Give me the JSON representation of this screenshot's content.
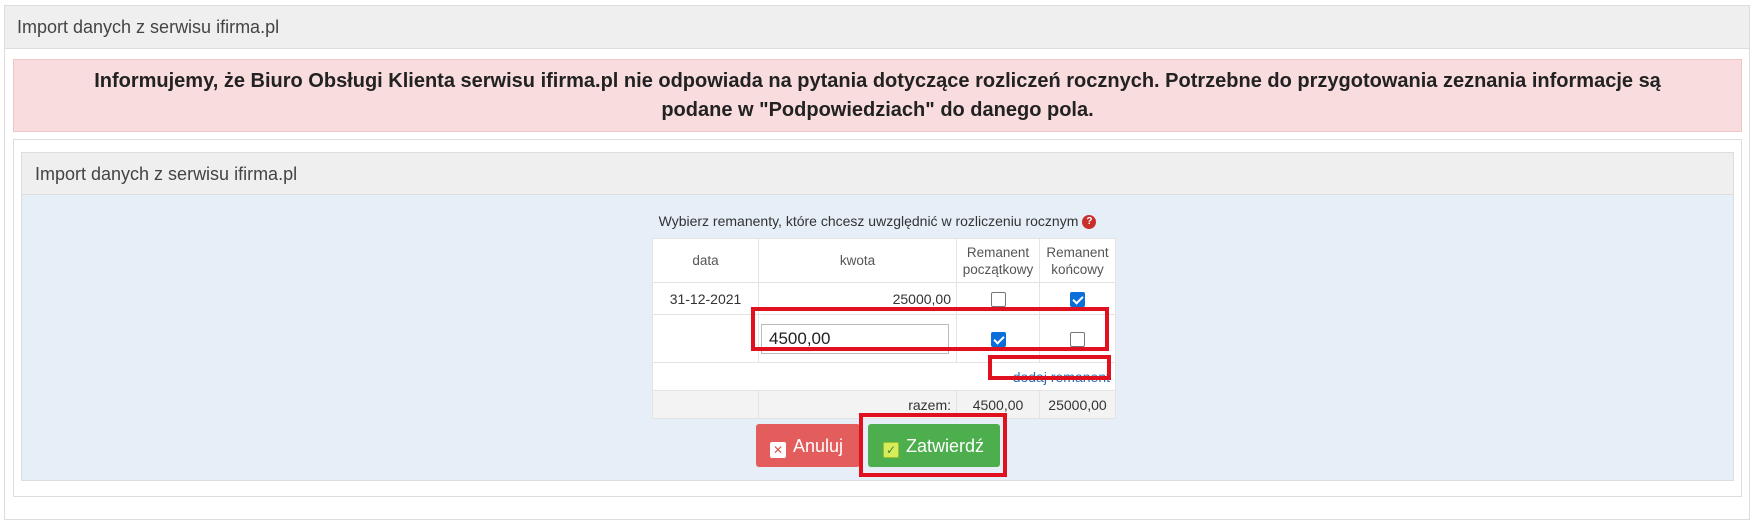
{
  "outer_panel": {
    "title": "Import danych z serwisu ifirma.pl"
  },
  "alert": {
    "line1": "Informujemy, że Biuro Obsługi Klienta serwisu ifirma.pl nie odpowiada na pytania dotyczące rozliczeń rocznych. Potrzebne do przygotowania zeznania informacje są",
    "line2": "podane w \"Podpowiedziach\" do danego pola."
  },
  "inner_panel": {
    "title": "Import danych z serwisu ifirma.pl",
    "instruction": "Wybierz remanenty, które chcesz uwzględnić w rozliczeniu rocznym",
    "help_icon": "question-circle-icon"
  },
  "table": {
    "headers": {
      "date": "data",
      "amount": "kwota",
      "opening_line1": "Remanent",
      "opening_line2": "początkowy",
      "closing_line1": "Remanent",
      "closing_line2": "końcowy"
    },
    "rows": [
      {
        "date": "31-12-2021",
        "amount": "25000,00",
        "opening": false,
        "closing": true
      },
      {
        "date": "",
        "amount_input": "4500,00",
        "opening": true,
        "closing": false
      }
    ],
    "add_link": "dodaj remanent",
    "total_label": "razem:",
    "total_opening": "4500,00",
    "total_closing": "25000,00"
  },
  "buttons": {
    "cancel": {
      "label": "Anuluj",
      "icon": "close-square-icon"
    },
    "confirm": {
      "label": "Zatwierdź",
      "icon": "check-square-icon"
    }
  },
  "colors": {
    "alert_bg": "#f9dcdd",
    "inner_bg": "#e6eef8",
    "cancel_bg": "#e35d5d",
    "confirm_bg": "#4cae4c",
    "highlight": "#e0101e",
    "link": "#2a6db1"
  }
}
